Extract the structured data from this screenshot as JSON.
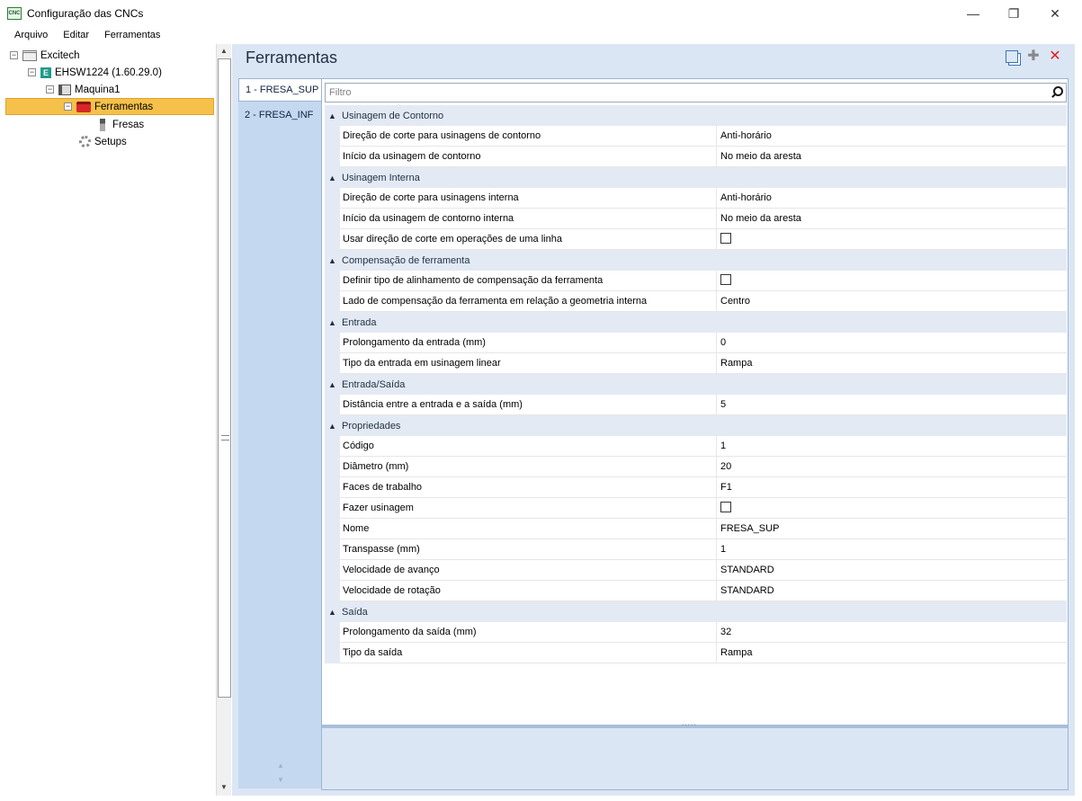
{
  "window": {
    "app_icon_text": "CNC",
    "title": "Configuração das CNCs",
    "minimize_glyph": "—",
    "restore_glyph": "❐",
    "close_glyph": "✕"
  },
  "menu": [
    "Arquivo",
    "Editar",
    "Ferramentas"
  ],
  "tree": {
    "collapse_glyph": "−",
    "items": [
      {
        "label": "Excitech",
        "icon": "factory-icon"
      },
      {
        "label": "EHSW1224 (1.60.29.0)",
        "icon": "ehsw-icon"
      },
      {
        "label": "Maquina1",
        "icon": "machine-icon"
      },
      {
        "label": "Ferramentas",
        "icon": "toolbox-icon",
        "selected": true
      },
      {
        "label": "Fresas",
        "icon": "drill-bit-icon"
      },
      {
        "label": "Setups",
        "icon": "gear-icon"
      }
    ]
  },
  "panel": {
    "title": "Ferramentas",
    "tabs": [
      "1 - FRESA_SUP",
      "2 - FRESA_INF"
    ],
    "filter_placeholder": "Filtro",
    "categories": [
      {
        "label": "Usinagem de Contorno",
        "props": [
          {
            "name": "Direção de corte para usinagens de contorno",
            "value": "Anti-horário"
          },
          {
            "name": "Início da usinagem de contorno",
            "value": "No meio da aresta"
          }
        ]
      },
      {
        "label": "Usinagem Interna",
        "props": [
          {
            "name": "Direção de corte para usinagens interna",
            "value": "Anti-horário"
          },
          {
            "name": "Início da usinagem de contorno interna",
            "value": "No meio da aresta"
          },
          {
            "name": "Usar direção de corte em operações de uma linha",
            "value": "",
            "checkbox": true
          }
        ]
      },
      {
        "label": "Compensação de ferramenta",
        "props": [
          {
            "name": "Definir tipo de alinhamento de compensação da ferramenta",
            "value": "",
            "checkbox": true
          },
          {
            "name": "Lado de compensação da ferramenta em relação a geometria interna",
            "value": "Centro"
          }
        ]
      },
      {
        "label": "Entrada",
        "props": [
          {
            "name": "Prolongamento da entrada (mm)",
            "value": "0"
          },
          {
            "name": "Tipo da entrada em usinagem linear",
            "value": "Rampa"
          }
        ]
      },
      {
        "label": "Entrada/Saída",
        "props": [
          {
            "name": "Distância entre a entrada e a saída (mm)",
            "value": "5"
          }
        ]
      },
      {
        "label": "Propriedades",
        "props": [
          {
            "name": "Código",
            "value": "1"
          },
          {
            "name": "Diâmetro (mm)",
            "value": "20"
          },
          {
            "name": "Faces de trabalho",
            "value": "F1"
          },
          {
            "name": "Fazer usinagem",
            "value": "",
            "checkbox": true
          },
          {
            "name": "Nome",
            "value": "FRESA_SUP"
          },
          {
            "name": "Transpasse (mm)",
            "value": "1"
          },
          {
            "name": "Velocidade de avanço",
            "value": "STANDARD"
          },
          {
            "name": "Velocidade de rotação",
            "value": "STANDARD"
          }
        ]
      },
      {
        "label": "Saída",
        "props": [
          {
            "name": "Prolongamento da saída (mm)",
            "value": "32"
          },
          {
            "name": "Tipo da saída",
            "value": "Rampa"
          }
        ]
      }
    ]
  }
}
